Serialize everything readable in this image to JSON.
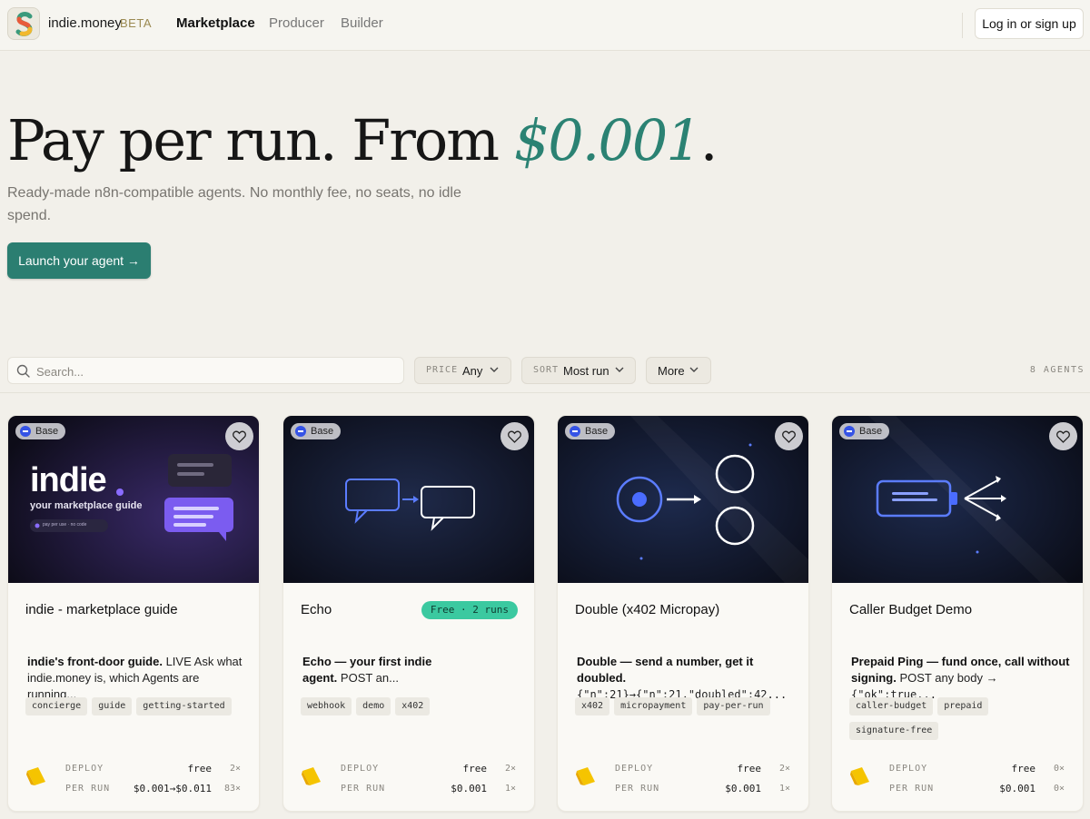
{
  "header": {
    "brand": "indie.money",
    "beta": "BETA",
    "nav": [
      "Marketplace",
      "Producer",
      "Builder"
    ],
    "login": "Log in or sign up"
  },
  "hero": {
    "title_prefix": "Pay per run. From ",
    "title_price": "$0.001",
    "title_suffix": ".",
    "subtitle": "Ready-made n8n-compatible agents. No monthly fee, no seats, no idle spend.",
    "cta": "Launch your agent →"
  },
  "filters": {
    "search_placeholder": "Search...",
    "price_key": "PRICE",
    "price_value": "Any",
    "sort_key": "SORT",
    "sort_value": "Most run",
    "more": "More",
    "count": "8 AGENTS"
  },
  "cards": [
    {
      "badge": "Base",
      "thumb_title": "indie",
      "thumb_subtitle": "your marketplace guide",
      "thumb_chip": "pay per use · no code",
      "title": "indie - marketplace guide",
      "pill": "",
      "desc_bold": "indie's front-door guide.",
      "desc_rest": " LIVE Ask what indie.money is, which Agents are running...",
      "tags": [
        "concierge",
        "guide",
        "getting-started"
      ],
      "deploy_label": "DEPLOY",
      "deploy_value": "free",
      "deploy_count": "2×",
      "run_label": "PER RUN",
      "run_value": "$0.001→$0.011",
      "run_count": "83×"
    },
    {
      "badge": "Base",
      "title": "Echo",
      "pill": "Free · 2 runs",
      "desc_bold": "Echo — your first indie agent.",
      "desc_rest": " POST an...",
      "tags": [
        "webhook",
        "demo",
        "x402"
      ],
      "deploy_label": "DEPLOY",
      "deploy_value": "free",
      "deploy_count": "2×",
      "run_label": "PER RUN",
      "run_value": "$0.001",
      "run_count": "1×"
    },
    {
      "badge": "Base",
      "title": "Double (x402 Micropay)",
      "pill": "",
      "desc_bold": "Double — send a number, get it doubled.",
      "desc_code": "{\"n\":21}→{\"n\":21,\"doubled\":42...",
      "tags": [
        "x402",
        "micropayment",
        "pay-per-run"
      ],
      "deploy_label": "DEPLOY",
      "deploy_value": "free",
      "deploy_count": "2×",
      "run_label": "PER RUN",
      "run_value": "$0.001",
      "run_count": "1×"
    },
    {
      "badge": "Base",
      "title": "Caller Budget Demo",
      "pill": "",
      "desc_bold": "Prepaid Ping — fund once, call without signing.",
      "desc_rest": " POST any body → ",
      "desc_code": "{\"ok\":true...",
      "tags": [
        "caller-budget",
        "prepaid",
        "signature-free"
      ],
      "deploy_label": "DEPLOY",
      "deploy_value": "free",
      "deploy_count": "0×",
      "run_label": "PER RUN",
      "run_value": "$0.001",
      "run_count": "0×"
    }
  ]
}
